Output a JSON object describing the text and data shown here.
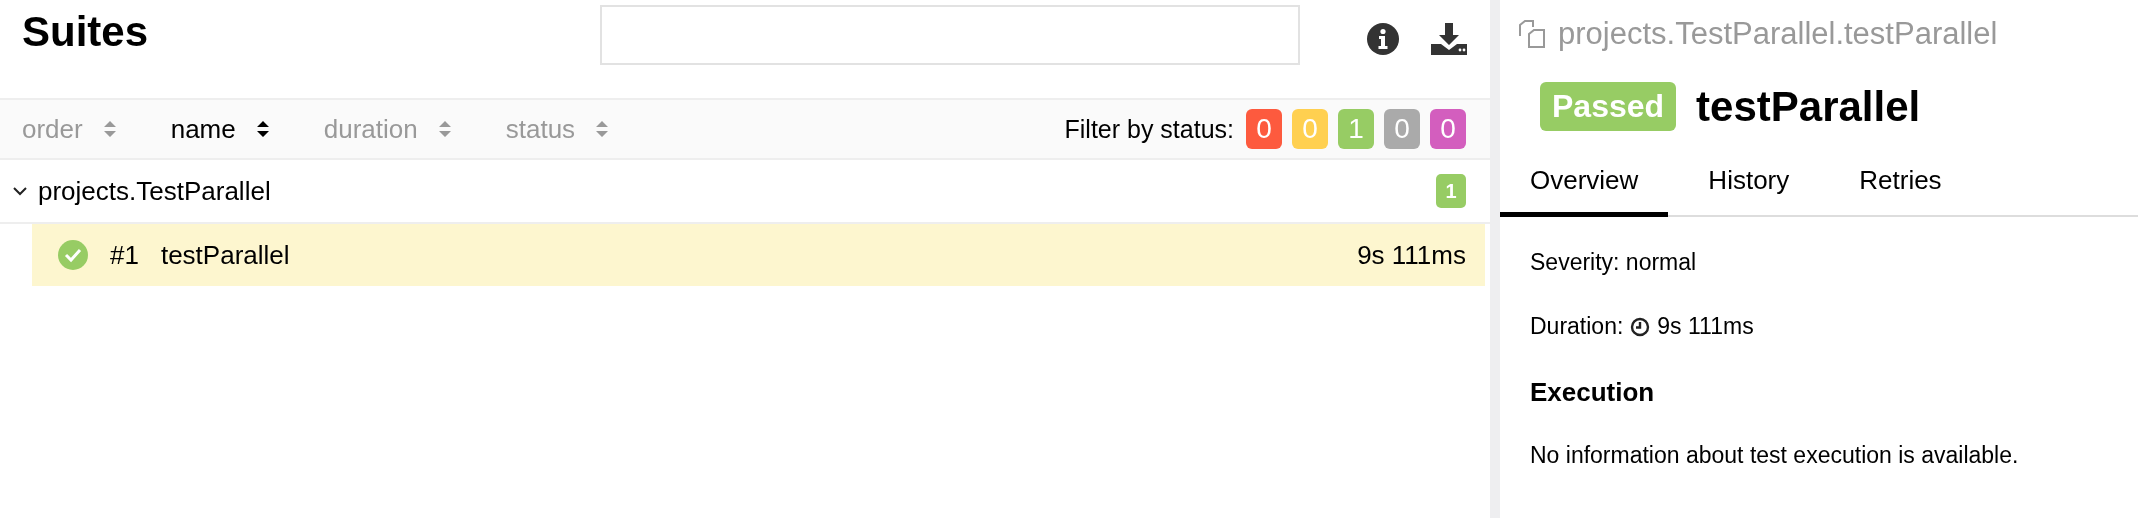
{
  "left": {
    "title": "Suites",
    "sort_columns": [
      {
        "label": "order",
        "sorted": false
      },
      {
        "label": "name",
        "sorted": true
      },
      {
        "label": "duration",
        "sorted": false
      },
      {
        "label": "status",
        "sorted": false
      }
    ],
    "filter": {
      "label": "Filter by status:",
      "counts": [
        {
          "count": "0",
          "color": "#fd5a3e"
        },
        {
          "count": "0",
          "color": "#ffd050"
        },
        {
          "count": "1",
          "color": "#97cc64"
        },
        {
          "count": "0",
          "color": "#aaaaaa"
        },
        {
          "count": "0",
          "color": "#d35ebe"
        }
      ]
    },
    "groups": [
      {
        "name": "projects.TestParallel",
        "expanded": true,
        "count": "1",
        "tests": [
          {
            "order": "#1",
            "name": "testParallel",
            "duration": "9s 111ms",
            "kind": "passed",
            "selected": true
          }
        ]
      }
    ]
  },
  "right": {
    "path": "projects.TestParallel.testParallel",
    "status": "Passed",
    "kind": "passed",
    "title": "testParallel",
    "tabs": [
      {
        "label": "Overview",
        "selected": true
      },
      {
        "label": "History",
        "selected": false
      },
      {
        "label": "Retries",
        "selected": false
      }
    ],
    "severity": "Severity: normal",
    "duration_label": "Duration:",
    "duration": "9s 111ms",
    "section_title": "Execution",
    "section_text": "No information about test execution is available."
  }
}
